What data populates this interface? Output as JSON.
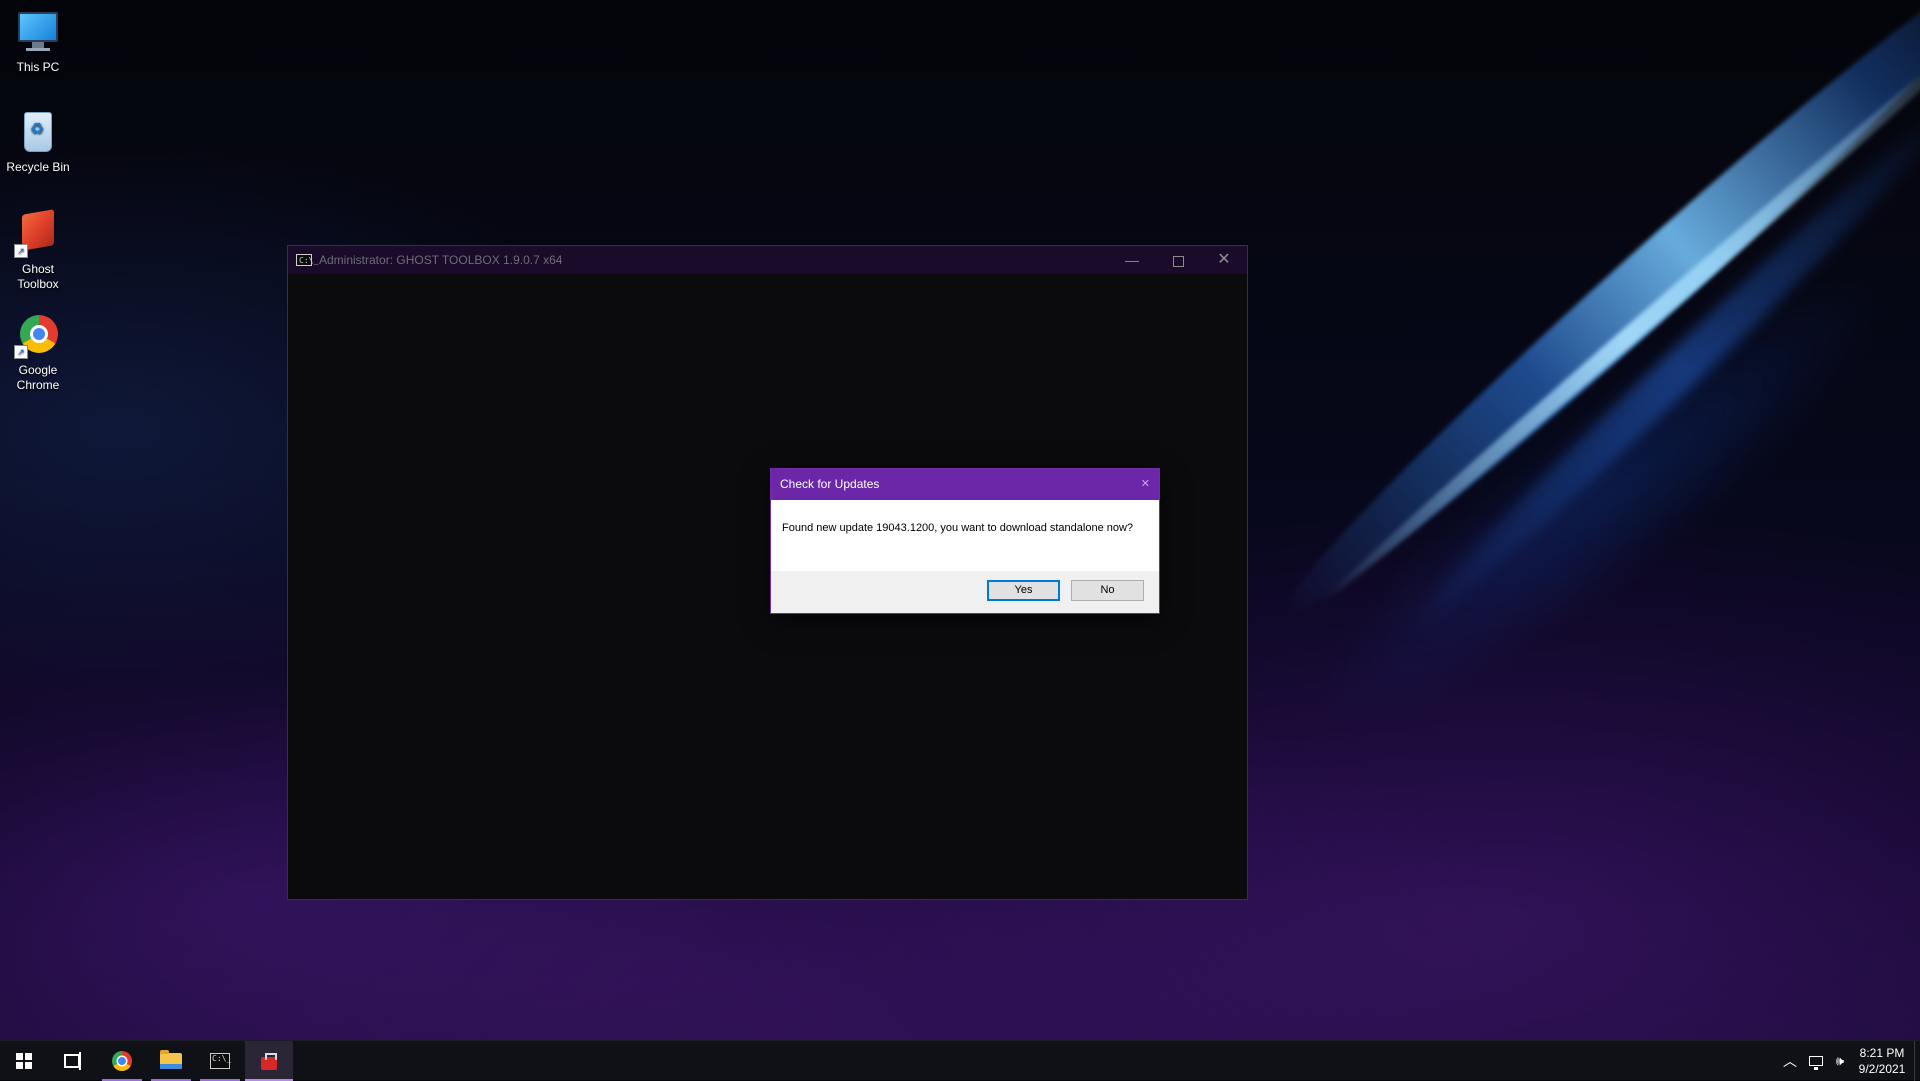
{
  "desktop": {
    "icons": [
      {
        "label": "This PC"
      },
      {
        "label": "Recycle Bin"
      },
      {
        "label": "Ghost Toolbox"
      },
      {
        "label": "Google Chrome"
      }
    ]
  },
  "console_window": {
    "title": "Administrator:  GHOST TOOLBOX 1.9.0.7 x64",
    "icon_text": "C:\\_",
    "minimize_symbol": "—",
    "close_symbol": "✕"
  },
  "dialog": {
    "title": "Check for Updates",
    "close_symbol": "✕",
    "message": "Found new update 19043.1200, you want to download standalone now?",
    "yes_label": "Yes",
    "no_label": "No"
  },
  "taskbar": {
    "items": [
      {
        "icon": "windows-start-icon"
      },
      {
        "icon": "task-view-icon"
      },
      {
        "icon": "chrome-icon"
      },
      {
        "icon": "file-explorer-icon"
      },
      {
        "icon": "command-prompt-icon"
      },
      {
        "icon": "ghost-toolbox-icon"
      }
    ],
    "tray": {
      "chevron": "︿",
      "volume": "🕪",
      "time": "8:21 PM",
      "date": "9/2/2021"
    }
  },
  "colors": {
    "dialog_title_bg": "#6b27a8",
    "console_title_bg": "#1a0b2a",
    "accent": "#0078d7"
  }
}
